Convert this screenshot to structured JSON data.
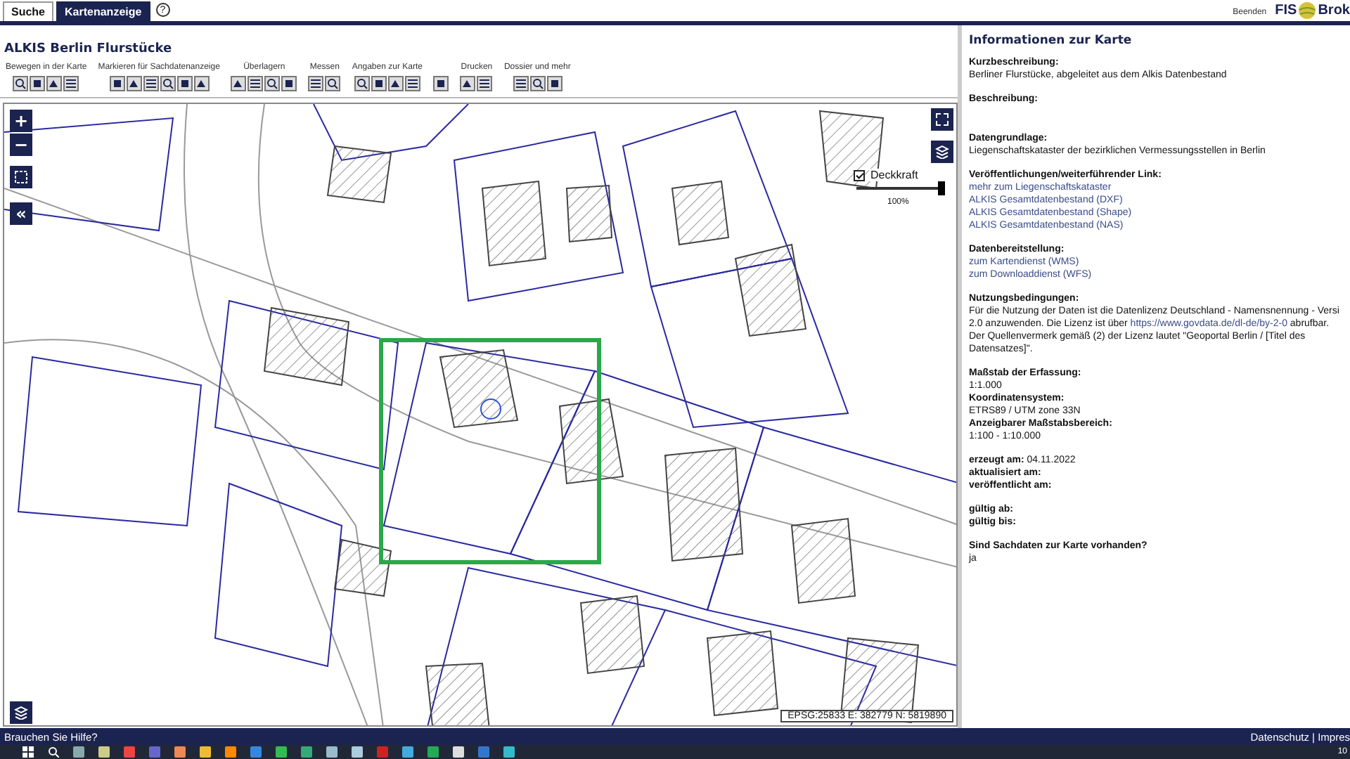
{
  "top_bar": {
    "tabs": [
      {
        "label": "Suche",
        "selected": false
      },
      {
        "label": "Kartenanzeige",
        "selected": true
      }
    ],
    "help": "?",
    "exit": "Beenden",
    "logo_left": "FIS",
    "logo_right": "Brok"
  },
  "map_title": "ALKIS Berlin Flurstücke",
  "toolbar": [
    {
      "label": "Bewegen in der Karte",
      "kind": "group"
    },
    {
      "label": "Markieren für Sachdatenanzeige",
      "kind": "group"
    },
    {
      "label": "Überlagern",
      "kind": "group"
    },
    {
      "label": "Messen",
      "kind": "group"
    },
    {
      "label": "Angaben zur Karte",
      "kind": "group"
    },
    {
      "kind": "single"
    },
    {
      "label": "Drucken",
      "kind": "group"
    },
    {
      "label": "Dossier und mehr",
      "kind": "group"
    }
  ],
  "map": {
    "zoom_in": "+",
    "zoom_out": "−",
    "collapse": "«",
    "opacity": {
      "label": "Deckkraft",
      "checked": true,
      "level": 1,
      "reading": "100%"
    },
    "coordinates": "EPSG:25833 E: 382779 N: 5819890"
  },
  "info": {
    "title": "Informationen zur Karte",
    "blocks": [
      {
        "rows": [
          {
            "kind": "heading",
            "text": "Kurzbeschreibung:"
          },
          {
            "kind": "text",
            "text": "Berliner Flurstücke, abgeleitet aus dem Alkis Datenbestand"
          }
        ]
      },
      {
        "rows": [
          {
            "kind": "heading",
            "text": "Beschreibung:"
          }
        ]
      },
      {
        "rows": [
          {
            "kind": "heading",
            "text": "Datengrundlage:"
          },
          {
            "kind": "text",
            "text": "Liegenschaftskataster der bezirklichen Vermessungsstellen in Berlin"
          }
        ]
      },
      {
        "rows": [
          {
            "kind": "heading",
            "text": "Veröffentlichungen/weiterführender Link:"
          },
          {
            "kind": "link",
            "text": "mehr zum Liegenschaftskataster"
          },
          {
            "kind": "link",
            "text": "ALKIS Gesamtdatenbestand (DXF)"
          },
          {
            "kind": "link",
            "text": "ALKIS Gesamtdatenbestand (Shape)"
          },
          {
            "kind": "link",
            "text": "ALKIS Gesamtdatenbestand (NAS)"
          }
        ]
      },
      {
        "rows": [
          {
            "kind": "heading",
            "text": "Datenbereitstellung:"
          },
          {
            "kind": "link",
            "text": "zum Kartendienst (WMS)"
          },
          {
            "kind": "link",
            "text": "zum Downloaddienst (WFS)"
          }
        ]
      },
      {
        "rows": [
          {
            "kind": "heading",
            "text": "Nutzungsbedingungen:"
          },
          {
            "kind": "text",
            "text": "Für die Nutzung der Daten ist die Datenlizenz Deutschland - Namensnennung - Versi"
          },
          {
            "kind": "mixed",
            "before": "2.0 anzuwenden. Die Lizenz ist über ",
            "link": "https://www.govdata.de/dl-de/by-2-0",
            "after": " abrufbar."
          },
          {
            "kind": "text",
            "text": "Der Quellenvermerk gemäß (2) der Lizenz lautet \"Geoportal Berlin / [Titel des"
          },
          {
            "kind": "text",
            "text": "Datensatzes]\"."
          }
        ]
      },
      {
        "rows": [
          {
            "kind": "heading",
            "text": "Maßstab der Erfassung:"
          },
          {
            "kind": "text",
            "text": "1:1.000"
          },
          {
            "kind": "heading",
            "text": "Koordinatensystem:"
          },
          {
            "kind": "text",
            "text": "ETRS89 / UTM zone 33N"
          },
          {
            "kind": "heading",
            "text": "Anzeigbarer Maßstabsbereich:"
          },
          {
            "kind": "text",
            "text": "1:100 - 1:10.000"
          }
        ]
      },
      {
        "rows": [
          {
            "kind": "field",
            "label": "erzeugt am:",
            "value": "04.11.2022"
          },
          {
            "kind": "heading",
            "text": "aktualisiert am:"
          },
          {
            "kind": "heading",
            "text": "veröffentlicht am:"
          }
        ]
      },
      {
        "rows": [
          {
            "kind": "heading",
            "text": "gültig ab:"
          },
          {
            "kind": "heading",
            "text": "gültig bis:"
          }
        ]
      },
      {
        "rows": [
          {
            "kind": "heading",
            "text": "Sind Sachdaten zur Karte vorhanden?"
          },
          {
            "kind": "text",
            "text": "ja"
          }
        ]
      }
    ]
  },
  "footer": {
    "help": "Brauchen Sie Hilfe?",
    "links": "Datenschutz | Impres"
  },
  "taskbar": {
    "clock": "10"
  }
}
